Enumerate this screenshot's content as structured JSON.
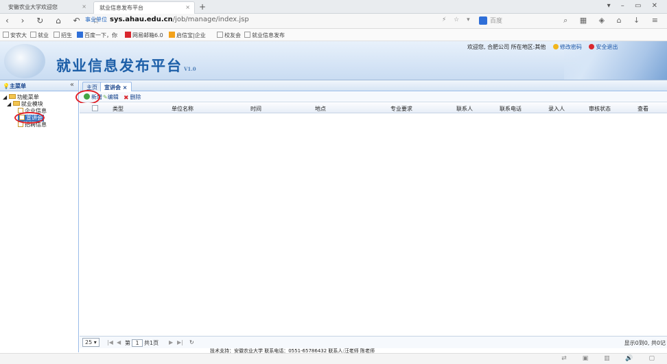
{
  "browser": {
    "tabs": [
      "安徽农业大学欢迎您",
      "就业信息发布平台"
    ],
    "url_security_label": "事业单位",
    "url_host": "sys.ahau.edu.cn",
    "url_path": "/job/manage/index.jsp",
    "search_placeholder": "百度",
    "bookmarks": [
      "安农大",
      "就业",
      "招生",
      "百度一下，你",
      "网易邮箱6.0",
      "启信宝|企业",
      "校友会",
      "就业信息发布"
    ]
  },
  "header": {
    "title": "就业信息发布平台",
    "version": "V1.0",
    "welcome": "欢迎您, 合肥公司 所在地区:其他",
    "change_password": "修改密码",
    "logout": "安全退出"
  },
  "sidebar": {
    "title": "主菜单",
    "collapse_glyph": "«",
    "tree": {
      "root": "功能菜单",
      "module": "就业模块",
      "items": [
        "企业信息",
        "宣讲会",
        "招聘信息"
      ]
    }
  },
  "content": {
    "tabs": [
      "主页",
      "宣讲会 ×"
    ],
    "toolbar": {
      "add": "新增",
      "edit": "编辑",
      "delete": "删除"
    },
    "columns": [
      "类型",
      "单位名称",
      "时间",
      "地点",
      "专业要求",
      "联系人",
      "联系电话",
      "录入人",
      "审核状态",
      "查看"
    ],
    "rows": [],
    "pager": {
      "page_size": "25",
      "page_prefix": "第",
      "page": "1",
      "page_suffix": "共1页",
      "info": "显示0到0, 共0记"
    }
  },
  "footer": "技术支持：安徽农业大学 联系电话：0551-65786432 联系人:汪老师 陈老师",
  "colors": {
    "accent": "#1d5fa8",
    "highlight": "#e21f26",
    "selected": "#3470bf"
  }
}
